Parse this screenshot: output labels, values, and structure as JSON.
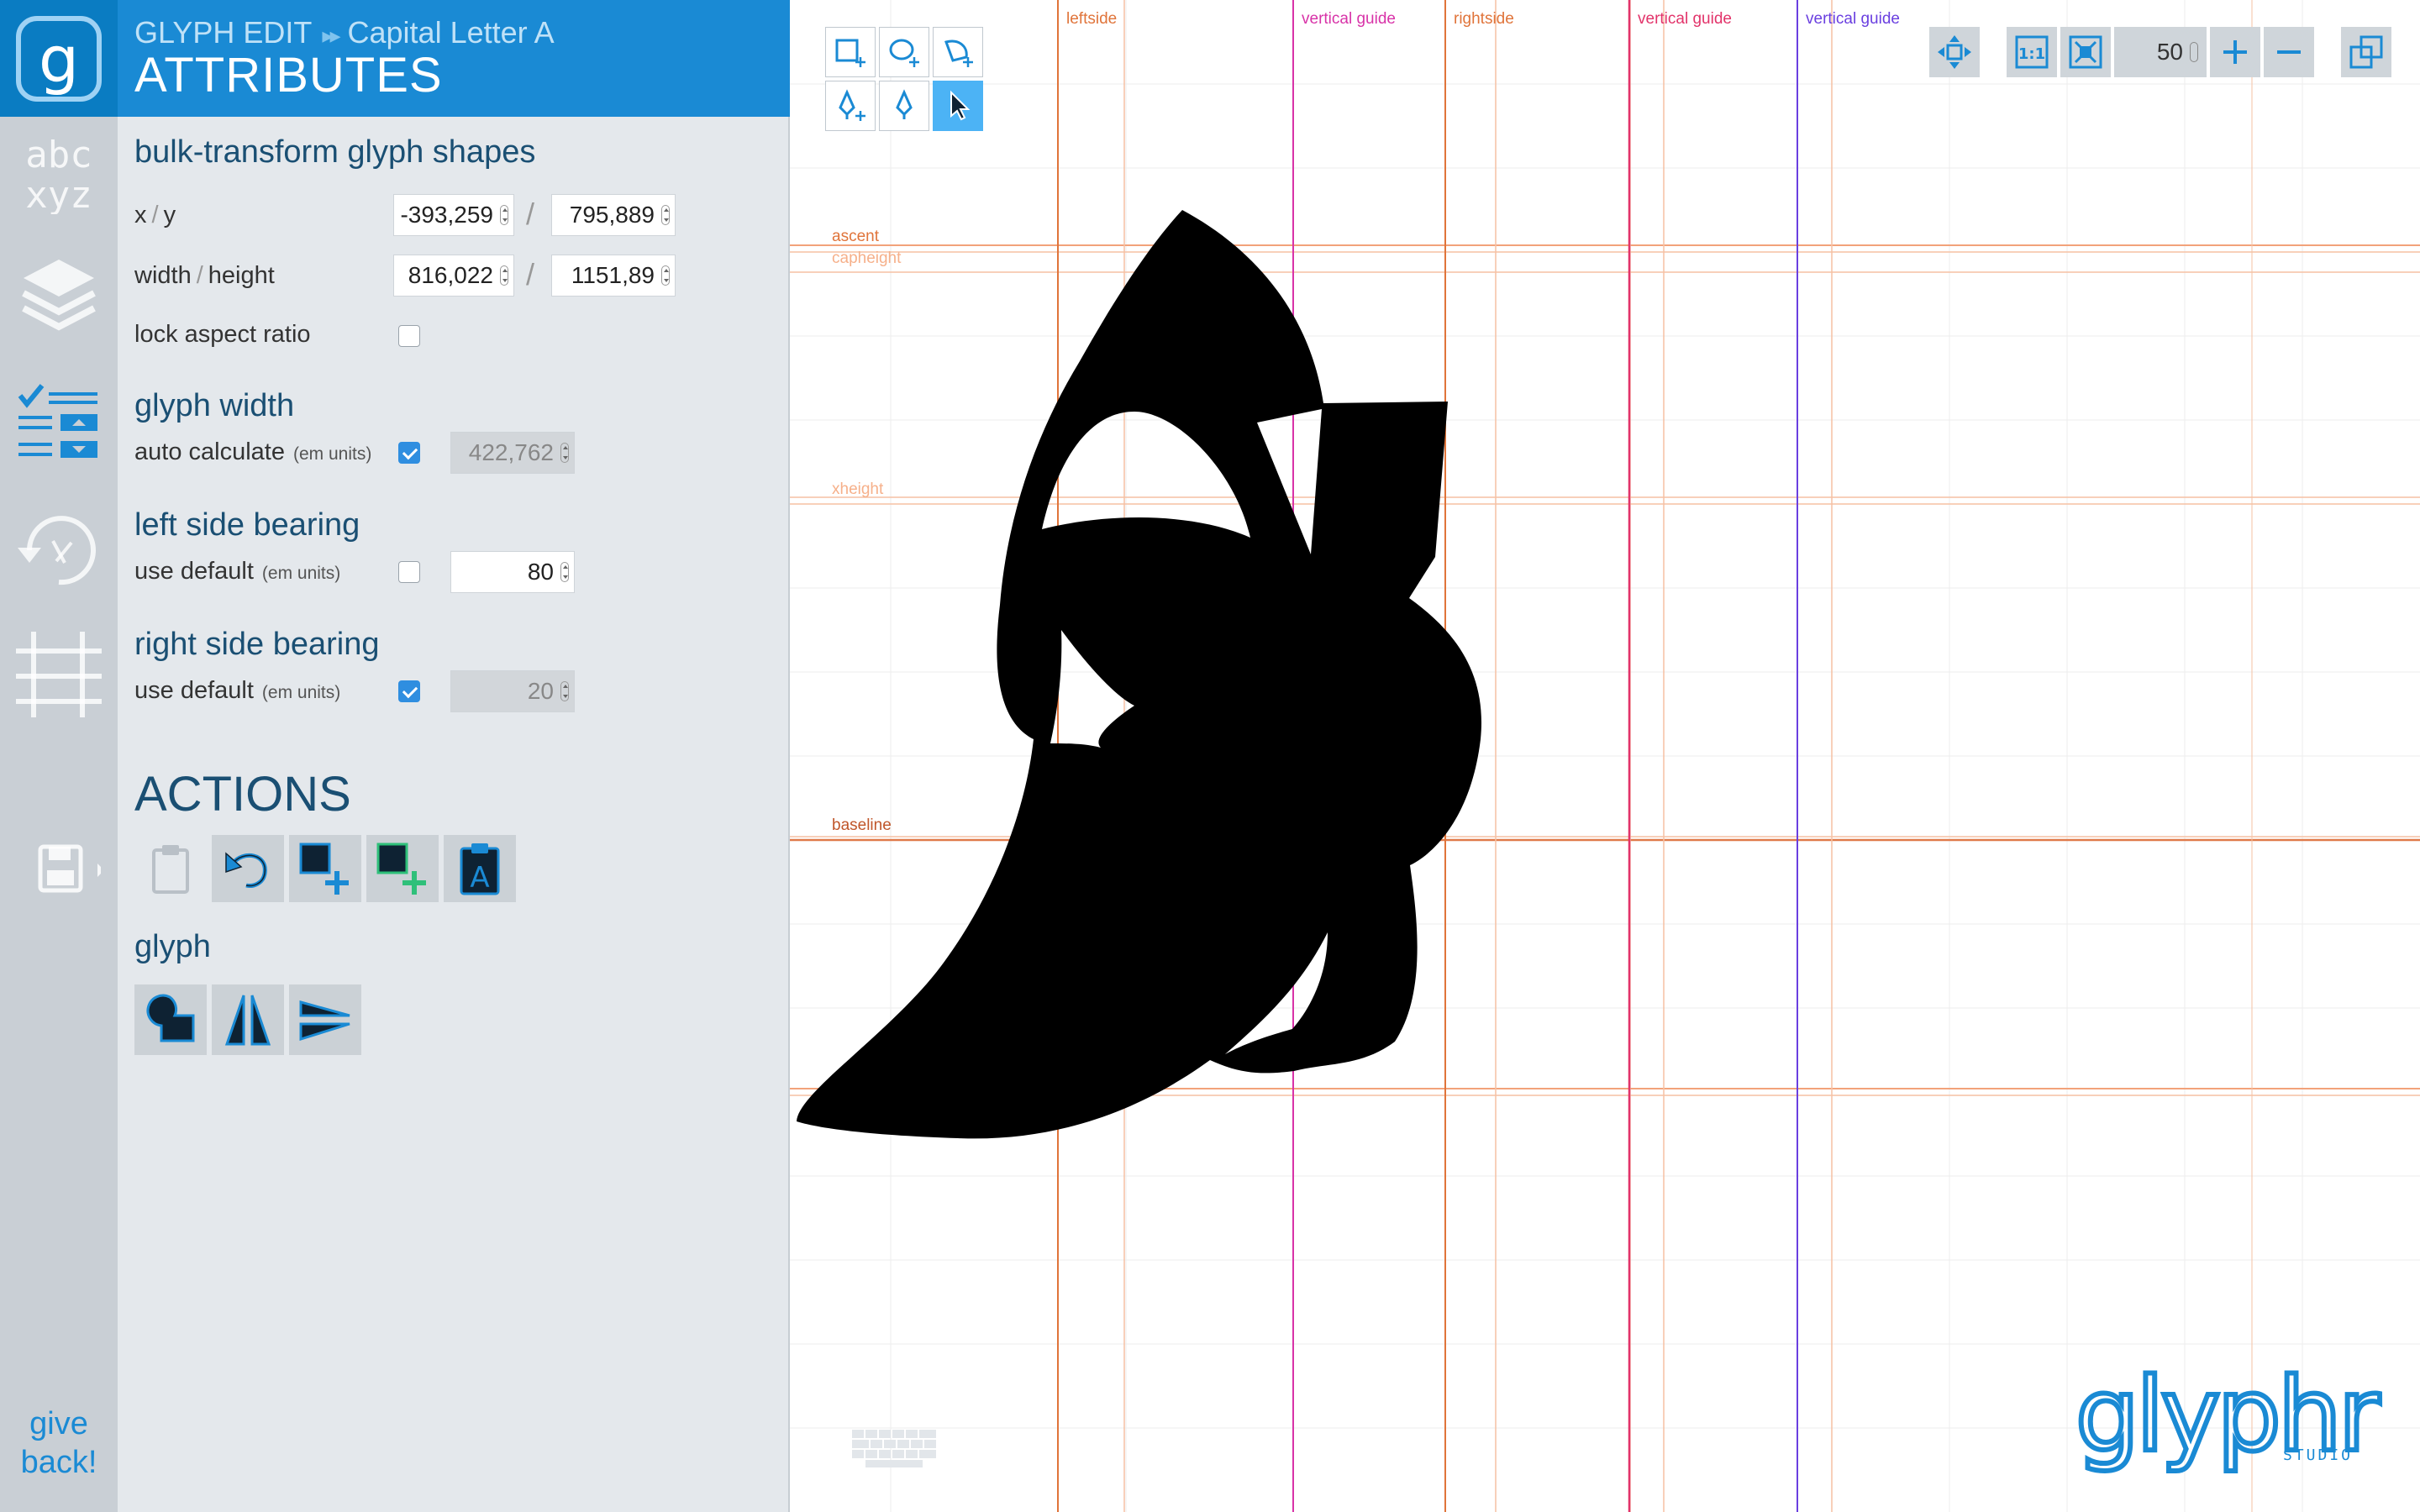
{
  "app": {
    "logo_letter": "g",
    "give_back": [
      "give",
      "back!"
    ],
    "nav_icons": [
      "glyph-chooser-icon",
      "layers-icon",
      "attributes-icon",
      "history-icon",
      "guides-icon",
      "save-icon"
    ]
  },
  "header": {
    "mode": "GLYPH EDIT",
    "breadcrumb_sep": "▸▸",
    "glyph_name": "Capital Letter A",
    "page_title": "ATTRIBUTES"
  },
  "bulk_transform": {
    "title": "bulk-transform glyph shapes",
    "xy_label_x": "x",
    "xy_label_y": "y",
    "x_value": "-393,259",
    "y_value": "795,889",
    "wh_label_w": "width",
    "wh_label_h": "height",
    "width_value": "816,022",
    "height_value": "1151,89",
    "slash": "/",
    "lock_label": "lock aspect ratio",
    "lock_checked": false
  },
  "glyph_width": {
    "title": "glyph width",
    "label": "auto calculate",
    "units": "(em units)",
    "checked": true,
    "value": "422,762"
  },
  "left_side_bearing": {
    "title": "left side bearing",
    "label": "use default",
    "units": "(em units)",
    "checked": false,
    "value": "80"
  },
  "right_side_bearing": {
    "title": "right side bearing",
    "label": "use default",
    "units": "(em units)",
    "checked": true,
    "value": "20"
  },
  "actions": {
    "title": "ACTIONS",
    "buttons": [
      "paste-icon",
      "undo-icon",
      "add-shape-icon",
      "add-component-icon",
      "paste-glyph-icon"
    ],
    "glyph_section_title": "glyph",
    "glyph_buttons": [
      "combine-shapes-icon",
      "flip-horizontal-icon",
      "flip-vertical-icon"
    ]
  },
  "canvas": {
    "zoom_value": "50",
    "guide_labels": {
      "leftside": "leftside",
      "rightside": "rightside",
      "vertical_guide": "vertical guide",
      "ascent": "ascent",
      "capheight": "capheight",
      "xheight": "xheight",
      "baseline": "baseline"
    },
    "colors": {
      "leftside": "#e0743a",
      "rightside": "#e0743a",
      "guide_1": "#d833a8",
      "guide_2": "#e2336a",
      "guide_3": "#6a3fe0",
      "metric": "#f2a27a",
      "baseline": "#e07a4a"
    },
    "brand_text": "glyphr",
    "brand_sub": "STUDIO"
  }
}
